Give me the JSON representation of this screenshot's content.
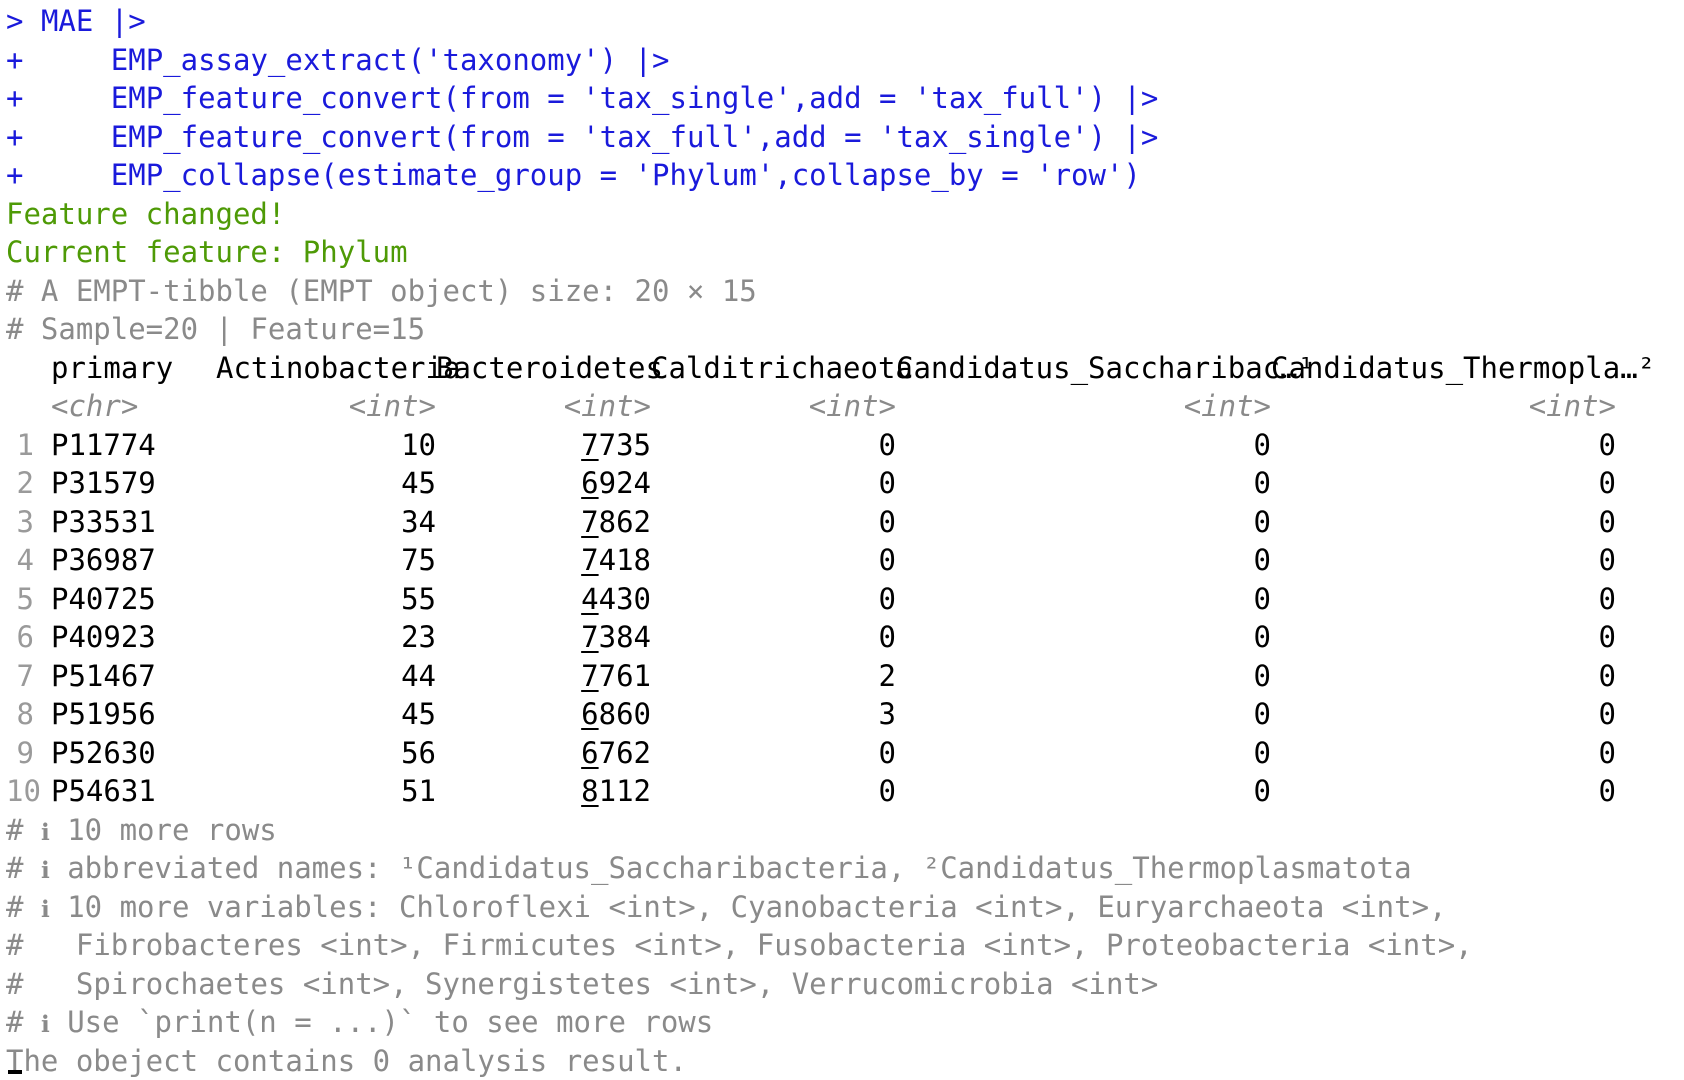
{
  "colors": {
    "command": "#1a1adb",
    "message": "#4e9a06",
    "comment": "#8a8a8a",
    "text": "#000000",
    "background": "#ffffff"
  },
  "command": {
    "prompt": ">",
    "continuation": "+",
    "lines": [
      "MAE |>",
      "    EMP_assay_extract('taxonomy') |>",
      "    EMP_feature_convert(from = 'tax_single',add = 'tax_full') |>",
      "    EMP_feature_convert(from = 'tax_full',add = 'tax_single') |>",
      "    EMP_collapse(estimate_group = 'Phylum',collapse_by = 'row')"
    ]
  },
  "messages": [
    "Feature changed!",
    "Current feature: Phylum"
  ],
  "summary": [
    "# A EMPT-tibble (EMPT object) size: 20 × 15",
    "# Sample=20 | Feature=15"
  ],
  "table": {
    "headers": [
      "primary",
      "Actinobacteria",
      "Bacteroidetes",
      "Calditrichaeota",
      "Candidatus_Saccharibac…¹",
      "Candidatus_Thermopla…²"
    ],
    "types": [
      "<chr>",
      "<int>",
      "<int>",
      "<int>",
      "<int>",
      "<int>"
    ],
    "rows": [
      {
        "idx": "1",
        "primary": "P11774",
        "actino": "10",
        "bact_lead": "7",
        "bact_rest": "735",
        "caldi": "0",
        "sacch": "0",
        "thermo": "0"
      },
      {
        "idx": "2",
        "primary": "P31579",
        "actino": "45",
        "bact_lead": "6",
        "bact_rest": "924",
        "caldi": "0",
        "sacch": "0",
        "thermo": "0"
      },
      {
        "idx": "3",
        "primary": "P33531",
        "actino": "34",
        "bact_lead": "7",
        "bact_rest": "862",
        "caldi": "0",
        "sacch": "0",
        "thermo": "0"
      },
      {
        "idx": "4",
        "primary": "P36987",
        "actino": "75",
        "bact_lead": "7",
        "bact_rest": "418",
        "caldi": "0",
        "sacch": "0",
        "thermo": "0"
      },
      {
        "idx": "5",
        "primary": "P40725",
        "actino": "55",
        "bact_lead": "4",
        "bact_rest": "430",
        "caldi": "0",
        "sacch": "0",
        "thermo": "0"
      },
      {
        "idx": "6",
        "primary": "P40923",
        "actino": "23",
        "bact_lead": "7",
        "bact_rest": "384",
        "caldi": "0",
        "sacch": "0",
        "thermo": "0"
      },
      {
        "idx": "7",
        "primary": "P51467",
        "actino": "44",
        "bact_lead": "7",
        "bact_rest": "761",
        "caldi": "2",
        "sacch": "0",
        "thermo": "0"
      },
      {
        "idx": "8",
        "primary": "P51956",
        "actino": "45",
        "bact_lead": "6",
        "bact_rest": "860",
        "caldi": "3",
        "sacch": "0",
        "thermo": "0"
      },
      {
        "idx": "9",
        "primary": "P52630",
        "actino": "56",
        "bact_lead": "6",
        "bact_rest": "762",
        "caldi": "0",
        "sacch": "0",
        "thermo": "0"
      },
      {
        "idx": "10",
        "primary": "P54631",
        "actino": "51",
        "bact_lead": "8",
        "bact_rest": "112",
        "caldi": "0",
        "sacch": "0",
        "thermo": "0"
      }
    ]
  },
  "footer": {
    "hash": "#",
    "info_symbol": "ℹ",
    "more_rows": "10 more rows",
    "abbreviated": "abbreviated names: ¹Candidatus_Saccharibacteria, ²Candidatus_Thermoplasmatota",
    "more_vars_1": "10 more variables: Chloroflexi <int>, Cyanobacteria <int>, Euryarchaeota <int>,",
    "more_vars_2": "  Fibrobacteres <int>, Firmicutes <int>, Fusobacteria <int>, Proteobacteria <int>,",
    "more_vars_3": "  Spirochaetes <int>, Synergistetes <int>, Verrucomicrobia <int>",
    "use_print": "Use `print(n = ...)` to see more rows",
    "result": "The obeject contains 0 analysis result."
  }
}
